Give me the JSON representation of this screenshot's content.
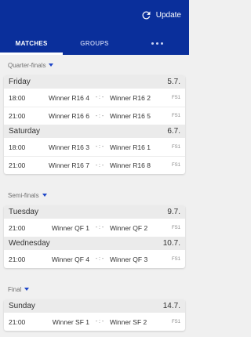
{
  "header": {
    "update_label": "Update",
    "tabs": [
      {
        "label": "MATCHES",
        "active": true
      },
      {
        "label": "GROUPS",
        "active": false
      }
    ],
    "icons": {
      "update": "refresh-icon",
      "more": "more-dots-icon"
    }
  },
  "colors": {
    "primary": "#0a2f9b",
    "accent": "#1e46c8",
    "background": "#f0f0f0"
  },
  "rounds": [
    {
      "title": "Quarter-finals",
      "days": [
        {
          "day": "Friday",
          "date": "5.7.",
          "matches": [
            {
              "time": "18:00",
              "home": "Winner R16 4",
              "score": "- : -",
              "away": "Winner R16 2",
              "tv": "FS1"
            },
            {
              "time": "21:00",
              "home": "Winner R16 6",
              "score": "- : -",
              "away": "Winner R16 5",
              "tv": "FS1"
            }
          ]
        },
        {
          "day": "Saturday",
          "date": "6.7.",
          "matches": [
            {
              "time": "18:00",
              "home": "Winner R16 3",
              "score": "- : -",
              "away": "Winner R16 1",
              "tv": "FS1"
            },
            {
              "time": "21:00",
              "home": "Winner R16 7",
              "score": "- : -",
              "away": "Winner R16 8",
              "tv": "FS1"
            }
          ]
        }
      ]
    },
    {
      "title": "Semi-finals",
      "days": [
        {
          "day": "Tuesday",
          "date": "9.7.",
          "matches": [
            {
              "time": "21:00",
              "home": "Winner QF 1",
              "score": "- : -",
              "away": "Winner QF 2",
              "tv": "FS1"
            }
          ]
        },
        {
          "day": "Wednesday",
          "date": "10.7.",
          "matches": [
            {
              "time": "21:00",
              "home": "Winner QF 4",
              "score": "- : -",
              "away": "Winner QF 3",
              "tv": "FS1"
            }
          ]
        }
      ]
    },
    {
      "title": "Final",
      "days": [
        {
          "day": "Sunday",
          "date": "14.7.",
          "matches": [
            {
              "time": "21:00",
              "home": "Winner SF 1",
              "score": "- : -",
              "away": "Winner SF 2",
              "tv": "FS1"
            }
          ]
        }
      ]
    }
  ]
}
